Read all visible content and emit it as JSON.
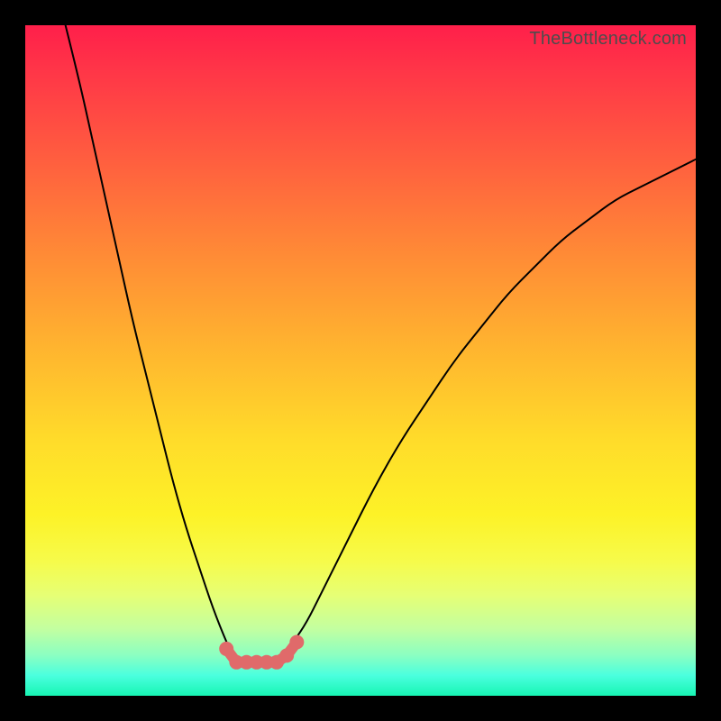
{
  "watermark": "TheBottleneck.com",
  "colors": {
    "background": "#000000",
    "curve": "#000000",
    "marker": "#e06a6a",
    "gradient_top": "#ff1f4a",
    "gradient_bottom": "#17f5b3"
  },
  "chart_data": {
    "type": "line",
    "title": "",
    "xlabel": "",
    "ylabel": "",
    "xlim": [
      0,
      100
    ],
    "ylim": [
      0,
      100
    ],
    "grid": false,
    "legend": false,
    "series": [
      {
        "name": "left-branch",
        "x": [
          6,
          8,
          10,
          12,
          14,
          16,
          18,
          20,
          22,
          24,
          26,
          28,
          30,
          31,
          32,
          33,
          34
        ],
        "y": [
          100,
          92,
          83,
          74,
          65,
          56,
          48,
          40,
          32,
          25,
          19,
          13,
          8,
          6,
          5,
          5,
          5
        ]
      },
      {
        "name": "right-branch",
        "x": [
          34,
          36,
          38,
          40,
          42,
          44,
          46,
          48,
          52,
          56,
          60,
          64,
          68,
          72,
          76,
          80,
          84,
          88,
          92,
          96,
          100
        ],
        "y": [
          5,
          5,
          6,
          8,
          11,
          15,
          19,
          23,
          31,
          38,
          44,
          50,
          55,
          60,
          64,
          68,
          71,
          74,
          76,
          78,
          80
        ]
      }
    ],
    "bottom_markers": {
      "name": "highlighted-region",
      "x": [
        30,
        31.5,
        33,
        34.5,
        36,
        37.5,
        39,
        40.5
      ],
      "y": [
        7,
        5,
        5,
        5,
        5,
        5,
        6,
        8
      ]
    }
  }
}
